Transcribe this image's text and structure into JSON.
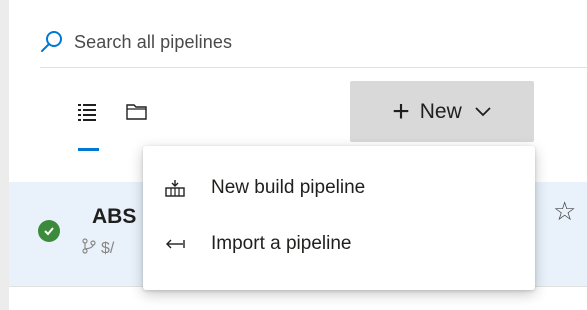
{
  "search": {
    "placeholder": "Search all pipelines"
  },
  "toolbar": {
    "new_label": "New"
  },
  "new_menu": {
    "items": [
      {
        "label": "New build pipeline",
        "icon": "build-pipeline-icon"
      },
      {
        "label": "Import a pipeline",
        "icon": "import-icon"
      }
    ]
  },
  "pipeline_row": {
    "title": "ABS",
    "subtitle": "$/"
  },
  "colors": {
    "accent": "#0078d4",
    "success": "#3c8b3c",
    "button_bg": "#d9d9d9",
    "row_highlight": "#e9f2fb"
  }
}
